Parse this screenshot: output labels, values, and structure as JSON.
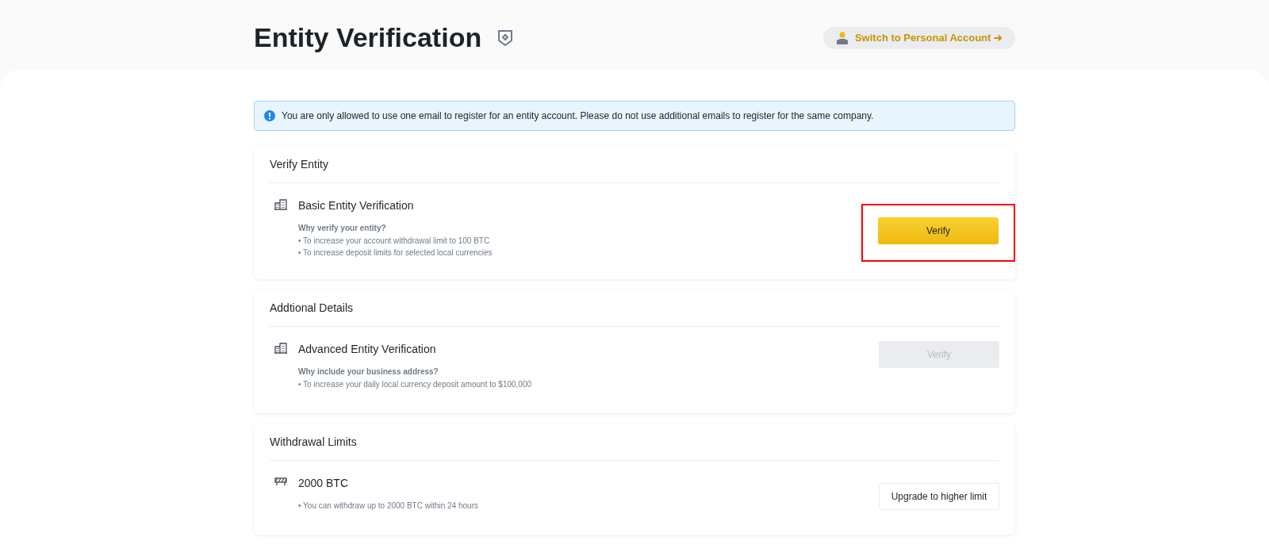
{
  "header": {
    "title": "Entity Verification",
    "switch_link": "Switch to Personal Account ➔"
  },
  "notice": "You are only allowed to use one email to register for an entity account. Please do not use additional emails to register for the same company.",
  "sections": [
    {
      "title": "Verify Entity",
      "item": {
        "kind": "building",
        "name": "Basic Entity Verification",
        "question": "Why verify your entity?",
        "points": [
          "• To increase your account withdrawal limit to 100 BTC",
          "• To increase deposit limits for selected local currencies"
        ]
      },
      "button": {
        "label": "Verify",
        "kind": "primary",
        "disabled": false,
        "highlighted": true
      }
    },
    {
      "title": "Addtional Details",
      "item": {
        "kind": "building",
        "name": "Advanced Entity Verification",
        "question": "Why include your business address?",
        "points": [
          "• To increase your daily local currency deposit amount to $100,000"
        ]
      },
      "button": {
        "label": "Verify",
        "kind": "primary",
        "disabled": true,
        "highlighted": false
      }
    },
    {
      "title": "Withdrawal Limits",
      "item": {
        "kind": "barrier",
        "name": "2000 BTC",
        "points": [
          "• You can withdraw up to 2000 BTC within 24 hours"
        ]
      },
      "button": {
        "label": "Upgrade to higher limit",
        "kind": "outline",
        "disabled": false,
        "highlighted": false
      }
    }
  ]
}
